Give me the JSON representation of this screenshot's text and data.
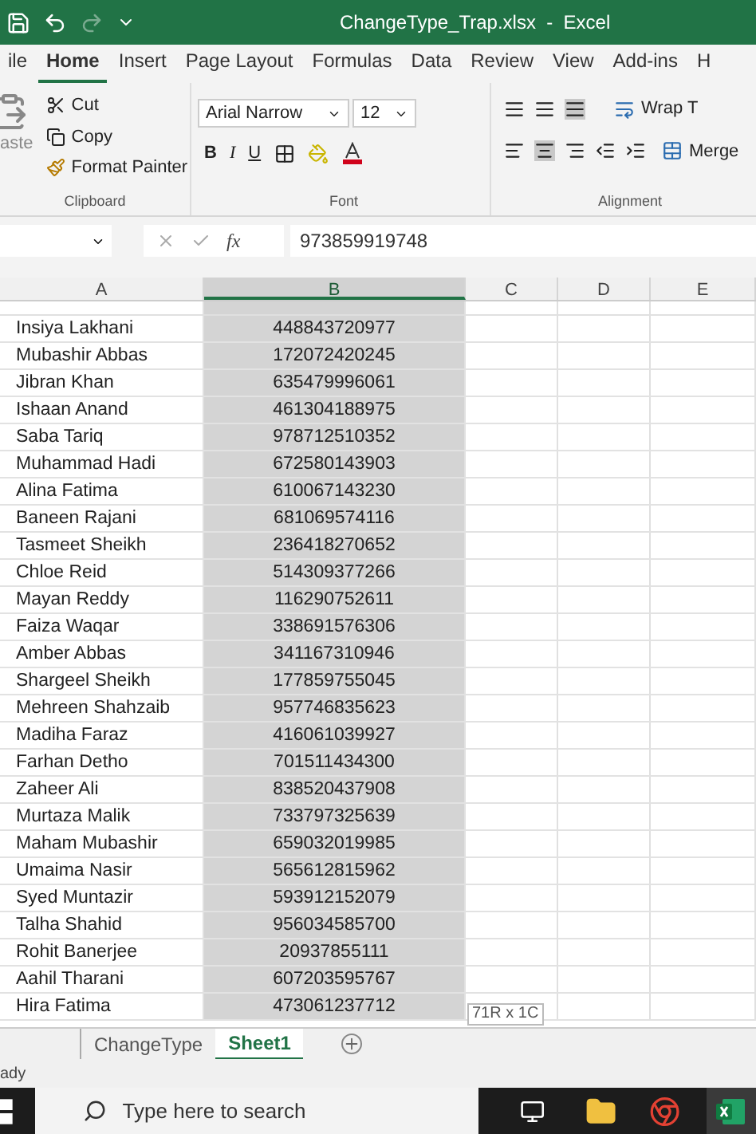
{
  "window": {
    "title": "ChangeType_Trap.xlsx  -  Excel"
  },
  "ribbon_tabs": [
    {
      "label": "ile",
      "selected": false
    },
    {
      "label": "Home",
      "selected": true
    },
    {
      "label": "Insert",
      "selected": false
    },
    {
      "label": "Page Layout",
      "selected": false
    },
    {
      "label": "Formulas",
      "selected": false
    },
    {
      "label": "Data",
      "selected": false
    },
    {
      "label": "Review",
      "selected": false
    },
    {
      "label": "View",
      "selected": false
    },
    {
      "label": "Add-ins",
      "selected": false
    },
    {
      "label": "H",
      "selected": false
    }
  ],
  "clipboard": {
    "paste": "aste",
    "cut": "Cut",
    "copy": "Copy",
    "format_painter": "Format Painter",
    "label": "Clipboard"
  },
  "font": {
    "name": "Arial Narrow",
    "size": "12",
    "bold": "B",
    "italic": "I",
    "underline": "U",
    "label": "Font"
  },
  "alignment": {
    "wrap": "Wrap T",
    "merge": "Merge",
    "label": "Alignment"
  },
  "formula_bar": {
    "fx": "fx",
    "value": "973859919748"
  },
  "columns": [
    {
      "label": "A",
      "selected": false
    },
    {
      "label": "B",
      "selected": true
    },
    {
      "label": "C",
      "selected": false
    },
    {
      "label": "D",
      "selected": false
    },
    {
      "label": "E",
      "selected": false
    }
  ],
  "rows": [
    {
      "name": "Insiya Lakhani",
      "number": "448843720977"
    },
    {
      "name": "Mubashir Abbas",
      "number": "172072420245"
    },
    {
      "name": "Jibran Khan",
      "number": "635479996061"
    },
    {
      "name": "Ishaan Anand",
      "number": "461304188975"
    },
    {
      "name": "Saba Tariq",
      "number": "978712510352"
    },
    {
      "name": "Muhammad Hadi",
      "number": "672580143903"
    },
    {
      "name": "Alina Fatima",
      "number": "610067143230"
    },
    {
      "name": "Baneen Rajani",
      "number": "681069574116"
    },
    {
      "name": "Tasmeet Sheikh",
      "number": "236418270652"
    },
    {
      "name": "Chloe Reid",
      "number": "514309377266"
    },
    {
      "name": "Mayan Reddy",
      "number": "116290752611"
    },
    {
      "name": "Faiza Waqar",
      "number": "338691576306"
    },
    {
      "name": "Amber Abbas",
      "number": "341167310946"
    },
    {
      "name": "Shargeel Sheikh",
      "number": "177859755045"
    },
    {
      "name": "Mehreen Shahzaib",
      "number": "957746835623"
    },
    {
      "name": "Madiha Faraz",
      "number": "416061039927"
    },
    {
      "name": "Farhan Detho",
      "number": "701511434300"
    },
    {
      "name": "Zaheer Ali",
      "number": "838520437908"
    },
    {
      "name": "Murtaza Malik",
      "number": "733797325639"
    },
    {
      "name": "Maham Mubashir",
      "number": "659032019985"
    },
    {
      "name": "Umaima Nasir",
      "number": "565612815962"
    },
    {
      "name": "Syed Muntazir",
      "number": "593912152079"
    },
    {
      "name": "Talha Shahid",
      "number": "956034585700"
    },
    {
      "name": "Rohit Banerjee",
      "number": "20937855111"
    },
    {
      "name": "Aahil Tharani",
      "number": "607203595767"
    },
    {
      "name": "Hira Fatima",
      "number": "473061237712"
    }
  ],
  "selection_tooltip": "71R x 1C",
  "sheet_tabs": [
    {
      "label": "ChangeType",
      "selected": false
    },
    {
      "label": "Sheet1",
      "selected": true
    }
  ],
  "status_bar": {
    "text": "ady"
  },
  "taskbar": {
    "search_placeholder": "Type here to search"
  }
}
